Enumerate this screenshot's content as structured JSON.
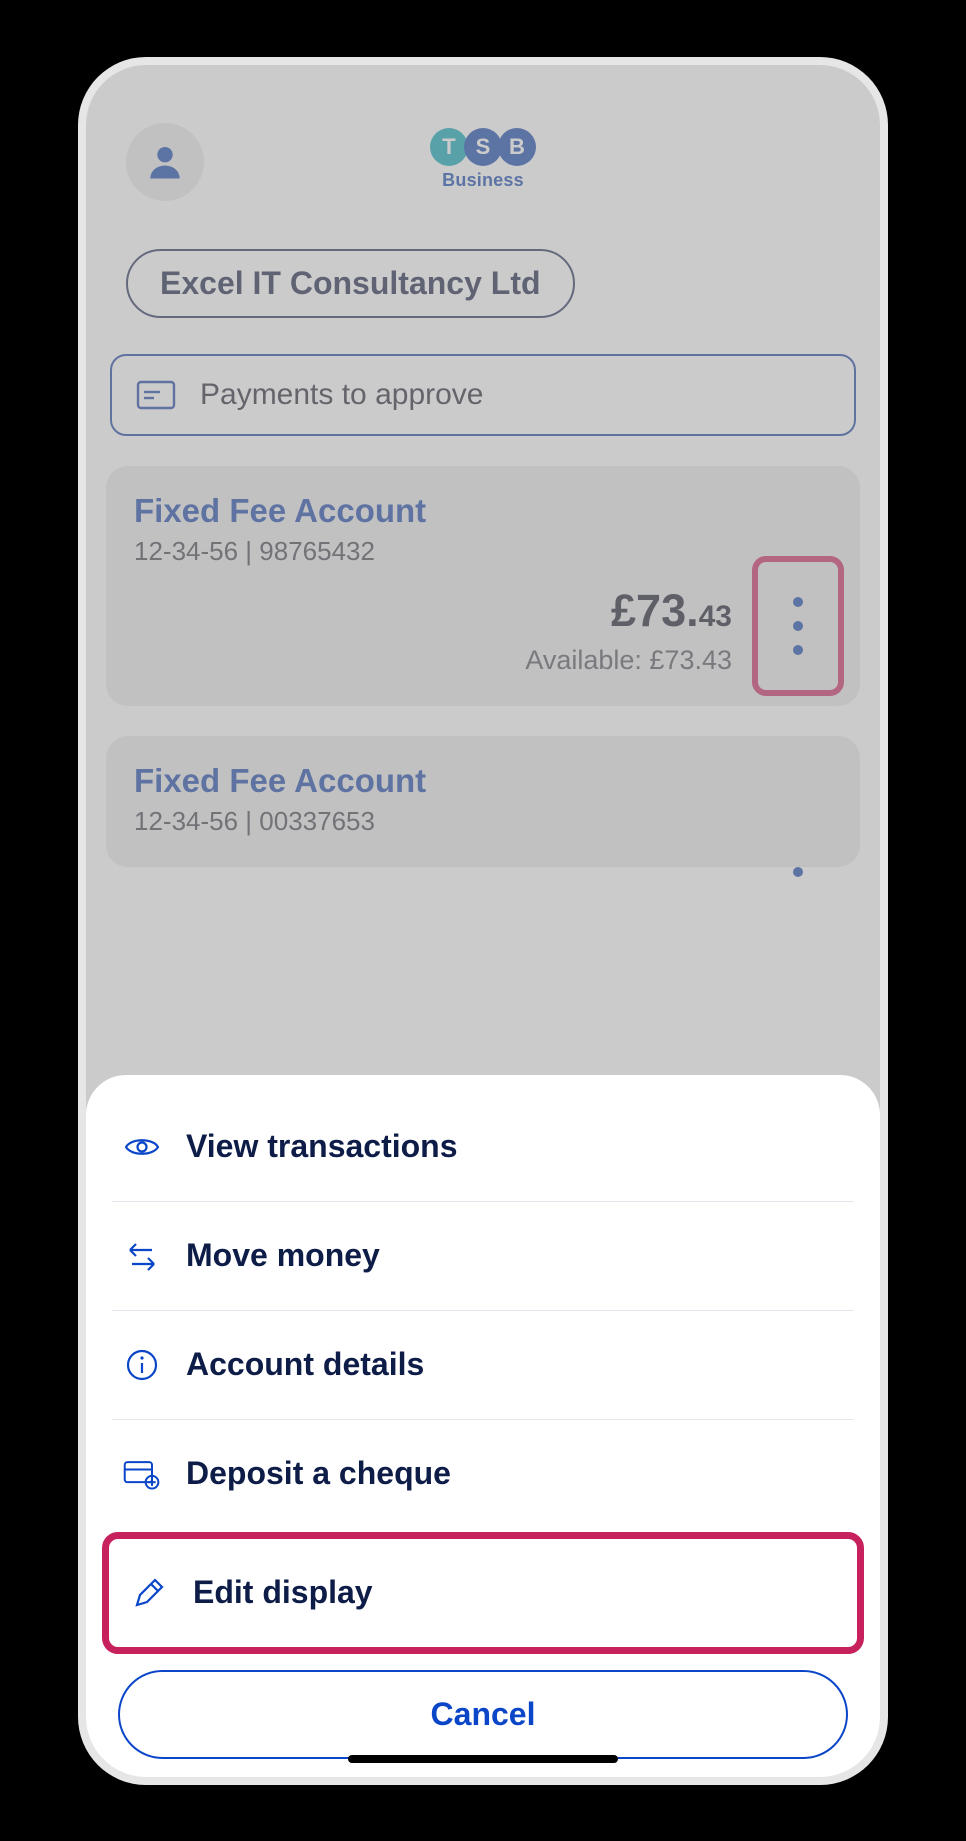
{
  "brand": {
    "letters": [
      "T",
      "S",
      "B"
    ],
    "sub": "Business"
  },
  "company_name": "Excel IT Consultancy Ltd",
  "approve_label": "Payments to approve",
  "accounts": [
    {
      "title": "Fixed Fee Account",
      "sort_acct": "12-34-56 | 98765432",
      "balance_major": "£73.",
      "balance_minor": "43",
      "available": "Available: £73.43"
    },
    {
      "title": "Fixed Fee Account",
      "sort_acct": "12-34-56 | 00337653"
    }
  ],
  "sheet": {
    "view_transactions": "View transactions",
    "move_money": "Move money",
    "account_details": "Account details",
    "deposit_cheque": "Deposit a cheque",
    "edit_display": "Edit display",
    "cancel": "Cancel"
  }
}
